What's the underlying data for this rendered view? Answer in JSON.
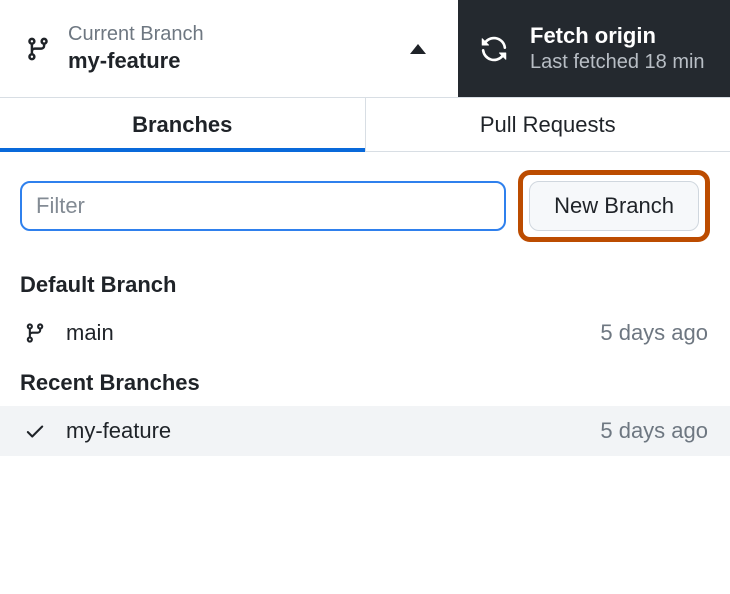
{
  "header": {
    "branch_label": "Current Branch",
    "branch_name": "my-feature",
    "fetch_title": "Fetch origin",
    "fetch_sub": "Last fetched 18 min"
  },
  "tabs": {
    "branches": "Branches",
    "pull_requests": "Pull Requests"
  },
  "toolbar": {
    "filter_placeholder": "Filter",
    "new_branch_label": "New Branch"
  },
  "sections": {
    "default_title": "Default Branch",
    "recent_title": "Recent Branches"
  },
  "default_branch": {
    "name": "main",
    "time": "5 days ago"
  },
  "recent_branches": [
    {
      "name": "my-feature",
      "time": "5 days ago"
    }
  ]
}
